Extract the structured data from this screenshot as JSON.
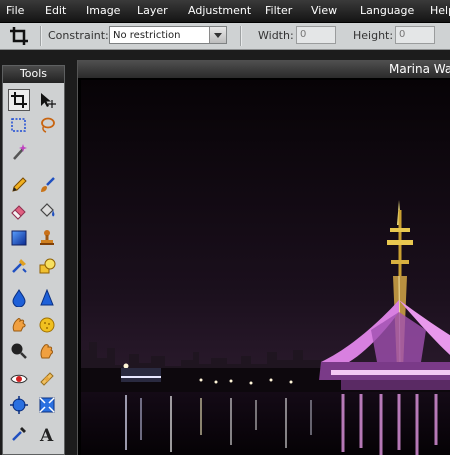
{
  "menu": [
    "File",
    "Edit",
    "Image",
    "Layer",
    "Adjustment",
    "Filter",
    "View",
    "Language",
    "Help"
  ],
  "options": {
    "constraint_label": "Constraint:",
    "constraint_value": "No restriction",
    "width_label": "Width:",
    "width_value": "0",
    "height_label": "Height:",
    "height_value": "0"
  },
  "tools_title": "Tools",
  "tools": [
    "crop-icon",
    "move-icon",
    "marquee-icon",
    "lasso-icon",
    "magic-wand-icon",
    "pencil-icon",
    "brush-icon",
    "eraser-icon",
    "paint-bucket-icon",
    "gradient-icon",
    "clone-stamp-icon",
    "color-replace-icon",
    "drawing-icon",
    "blur-icon",
    "sharpen-icon",
    "smudge-icon",
    "sponge-icon",
    "dodge-icon",
    "burn-icon",
    "red-eye-icon",
    "spot-heal-icon",
    "bloat-icon",
    "pinch-icon",
    "color-picker-icon",
    "type-icon"
  ],
  "document_title": "Marina Wa",
  "photo": {
    "subject": "night skyline with illuminated tower and tent structure reflected in water"
  }
}
